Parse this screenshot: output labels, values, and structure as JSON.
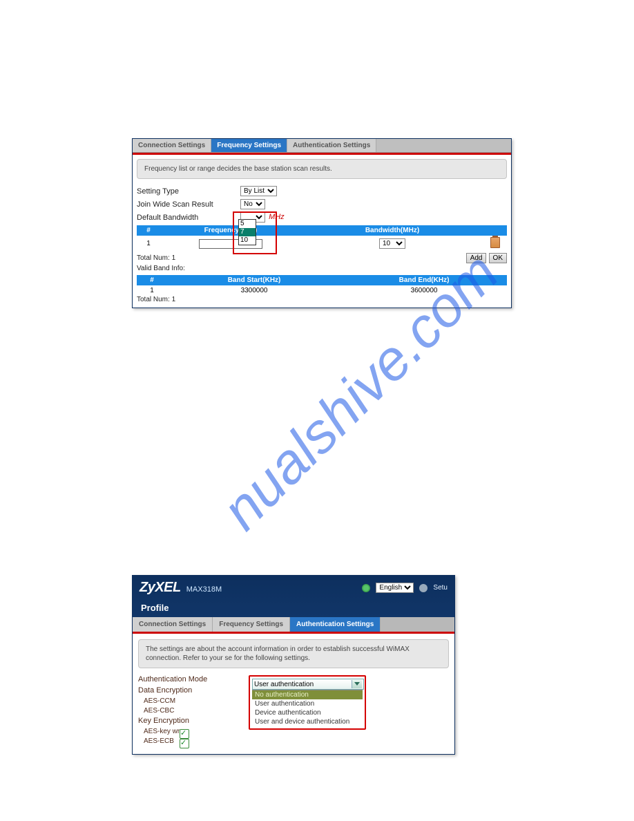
{
  "watermark": "nualshive.com",
  "screenshot1": {
    "tabs": [
      {
        "label": "Connection Settings",
        "active": false
      },
      {
        "label": "Frequency Settings",
        "active": true
      },
      {
        "label": "Authentication Settings",
        "active": false
      }
    ],
    "info": "Frequency list or range decides the base station scan results.",
    "setting_type": {
      "label": "Setting Type",
      "value": "By List"
    },
    "join_wide": {
      "label": "Join Wide Scan Result",
      "value": "No"
    },
    "default_bw": {
      "label": "Default Bandwidth",
      "unit": "MHz"
    },
    "table1_headers": [
      "#",
      "Frequency(KHz)",
      "Bandwidth(MHz)"
    ],
    "table1_row": {
      "idx": "1",
      "bw": "10"
    },
    "bw_options": [
      "5",
      "7",
      "10"
    ],
    "total_num_1": "Total Num: 1",
    "valid_band_info": "Valid Band Info:",
    "table2_headers": [
      "#",
      "Band Start(KHz)",
      "Band End(KHz)"
    ],
    "table2_row": {
      "idx": "1",
      "start": "3300000",
      "end": "3600000"
    },
    "total_num_2": "Total Num: 1",
    "buttons": {
      "add": "Add",
      "ok": "OK"
    }
  },
  "screenshot2": {
    "brand": "ZyXEL",
    "model": "MAX318M",
    "language_label": "English",
    "setup_label": "Setu",
    "section_title": "Profile",
    "tabs": [
      {
        "label": "Connection Settings",
        "active": false
      },
      {
        "label": "Frequency Settings",
        "active": false
      },
      {
        "label": "Authentication Settings",
        "active": true
      }
    ],
    "info": "The settings are about the account information in order to establish successful WiMAX connection. Refer to your se for the following settings.",
    "auth_mode": {
      "label": "Authentication Mode",
      "value": "User authentication"
    },
    "auth_options": [
      {
        "label": "No authentication",
        "highlight": true
      },
      {
        "label": "User authentication",
        "highlight": false
      },
      {
        "label": "Device authentication",
        "highlight": false
      },
      {
        "label": "User and device authentication",
        "highlight": false
      }
    ],
    "data_enc": {
      "label": "Data Encryption",
      "items": [
        "AES-CCM",
        "AES-CBC"
      ]
    },
    "key_enc": {
      "label": "Key Encryption",
      "items": [
        "AES-key wrap",
        "AES-ECB"
      ]
    }
  }
}
